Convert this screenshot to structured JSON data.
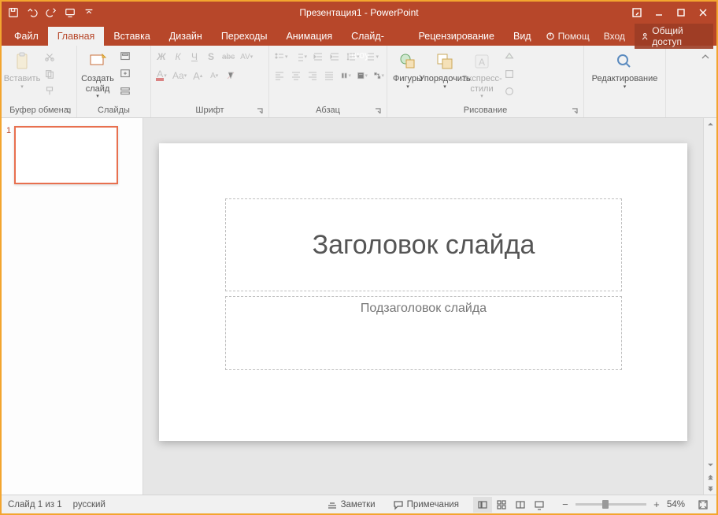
{
  "titlebar": {
    "title": "Презентация1 - PowerPoint"
  },
  "tabs": {
    "file": "Файл",
    "items": [
      "Главная",
      "Вставка",
      "Дизайн",
      "Переходы",
      "Анимация",
      "Слайд-шоу",
      "Рецензирование",
      "Вид"
    ],
    "active_index": 0,
    "help": "Помощ",
    "signin": "Вход",
    "share": "Общий доступ"
  },
  "ribbon": {
    "clipboard": {
      "label": "Буфер обмена",
      "paste": "Вставить"
    },
    "slides": {
      "label": "Слайды",
      "new_slide": "Создать\nслайд"
    },
    "font": {
      "label": "Шрифт",
      "bold": "Ж",
      "italic": "К",
      "underline": "Ч",
      "shadow": "S",
      "strike": "abc",
      "spacing": "AV",
      "case": "Aa"
    },
    "paragraph": {
      "label": "Абзац"
    },
    "drawing": {
      "label": "Рисование",
      "shapes": "Фигуры",
      "arrange": "Упорядочить",
      "express": "Экспресс-\nстили"
    },
    "editing": {
      "label": "",
      "button": "Редактирование"
    }
  },
  "slide": {
    "title_placeholder": "Заголовок слайда",
    "subtitle_placeholder": "Подзаголовок слайда",
    "thumb_number": "1"
  },
  "status": {
    "slide_of": "Слайд 1 из 1",
    "lang": "русский",
    "notes": "Заметки",
    "comments": "Примечания",
    "zoom": "54%"
  }
}
